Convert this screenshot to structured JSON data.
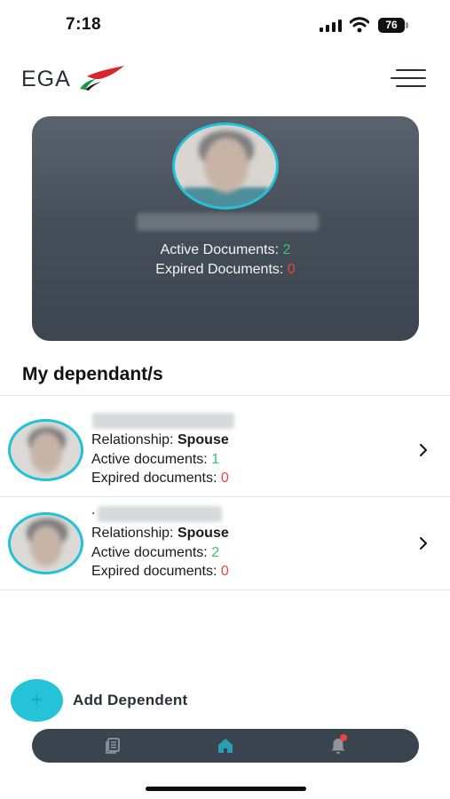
{
  "status_bar": {
    "time": "7:18",
    "battery": "76",
    "icons": [
      "signal-icon",
      "wifi-icon",
      "battery-icon"
    ]
  },
  "header": {
    "logo_text": "EGA",
    "logo_icon": "flag-icon",
    "menu_icon": "hamburger-menu-icon"
  },
  "profile": {
    "active_label": "Active Documents:",
    "active_count": "2",
    "expired_label": "Expired Documents:",
    "expired_count": "0"
  },
  "dependants": {
    "title": "My dependant/s",
    "items": [
      {
        "relationship_label": "Relationship:",
        "relationship": "Spouse",
        "active_label": "Active documents:",
        "active_count": "1",
        "expired_label": "Expired documents:",
        "expired_count": "0"
      },
      {
        "prefix": ".",
        "relationship_label": "Relationship:",
        "relationship": "Spouse",
        "active_label": "Active documents:",
        "active_count": "2",
        "expired_label": "Expired documents:",
        "expired_count": "0"
      }
    ]
  },
  "add_dependent": {
    "label": "Add Dependent",
    "icon_text": "+"
  },
  "bottom_nav": {
    "items": [
      "documents-icon",
      "home-icon",
      "bell-icon"
    ]
  },
  "colors": {
    "accent": "#25c3d8",
    "active_green": "#36c468",
    "expired_red": "#f0433b",
    "card_dark": "#454e58",
    "nav_dark": "#3a444f"
  }
}
